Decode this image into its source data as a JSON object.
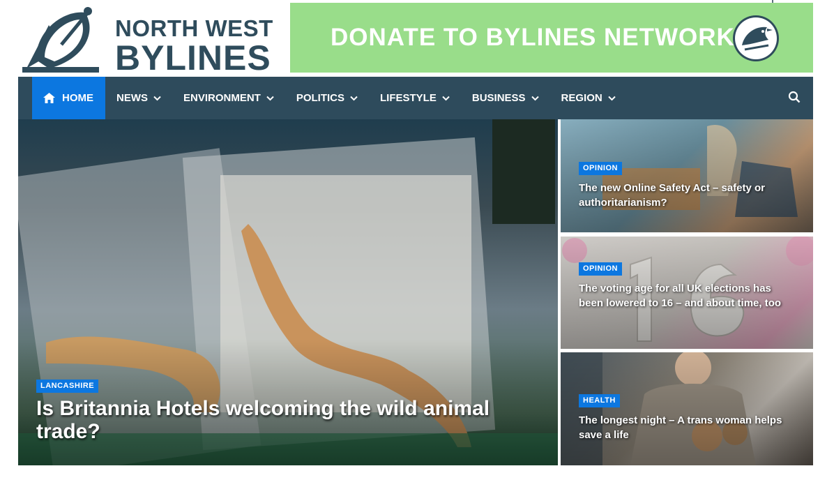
{
  "logo": {
    "line1": "NORTH WEST",
    "line2": "BYLINES"
  },
  "banner": {
    "text": "DONATE TO BYLINES NETWORK",
    "color": "#99dd8a"
  },
  "nav": {
    "items": [
      {
        "label": "HOME",
        "icon": "home-icon"
      },
      {
        "label": "NEWS",
        "icon": "chevron-down-icon"
      },
      {
        "label": "ENVIRONMENT",
        "icon": "chevron-down-icon"
      },
      {
        "label": "POLITICS",
        "icon": "chevron-down-icon"
      },
      {
        "label": "LIFESTYLE",
        "icon": "chevron-down-icon"
      },
      {
        "label": "BUSINESS",
        "icon": "chevron-down-icon"
      },
      {
        "label": "REGION",
        "icon": "chevron-down-icon"
      }
    ],
    "search_icon": "search-icon",
    "bg_color": "#2e4b5c",
    "active_color": "#0c77e0"
  },
  "hero": {
    "category": "LANCASHIRE",
    "title": "Is Britannia Hotels welcoming the wild animal trade?"
  },
  "cards": [
    {
      "category": "OPINION",
      "title": "The new Online Safety Act – safety or authoritarianism?"
    },
    {
      "category": "OPINION",
      "title": "The voting age for all UK elections has been lowered to 16 – and about time, too"
    },
    {
      "category": "HEALTH",
      "title": "The longest night – A trans woman helps save a life"
    }
  ]
}
